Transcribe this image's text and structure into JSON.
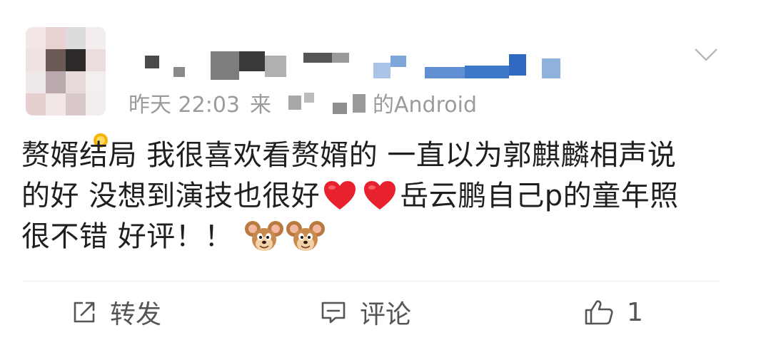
{
  "post": {
    "meta": {
      "time": "昨天 22:03",
      "source_prefix": "来",
      "source_suffix": "的Android"
    },
    "text": {
      "line1": "赘婿结局 我很喜欢看赘婿的 一直以为郭麒麟相声说",
      "line2_a": "的好 没想到演技也很好",
      "line2_b": "岳云鹏自己p的童年照",
      "line3": "很不错 好评！！"
    },
    "emoji": {
      "heart": "red-heart",
      "mouse": "jerry-mouse-face"
    },
    "actions": {
      "repost_label": "转发",
      "comment_label": "评论",
      "like_count": "1"
    },
    "colors": {
      "text": "#1f1f1f",
      "meta": "#9b9b9b",
      "action": "#555555",
      "heart": "#e8212e"
    }
  }
}
